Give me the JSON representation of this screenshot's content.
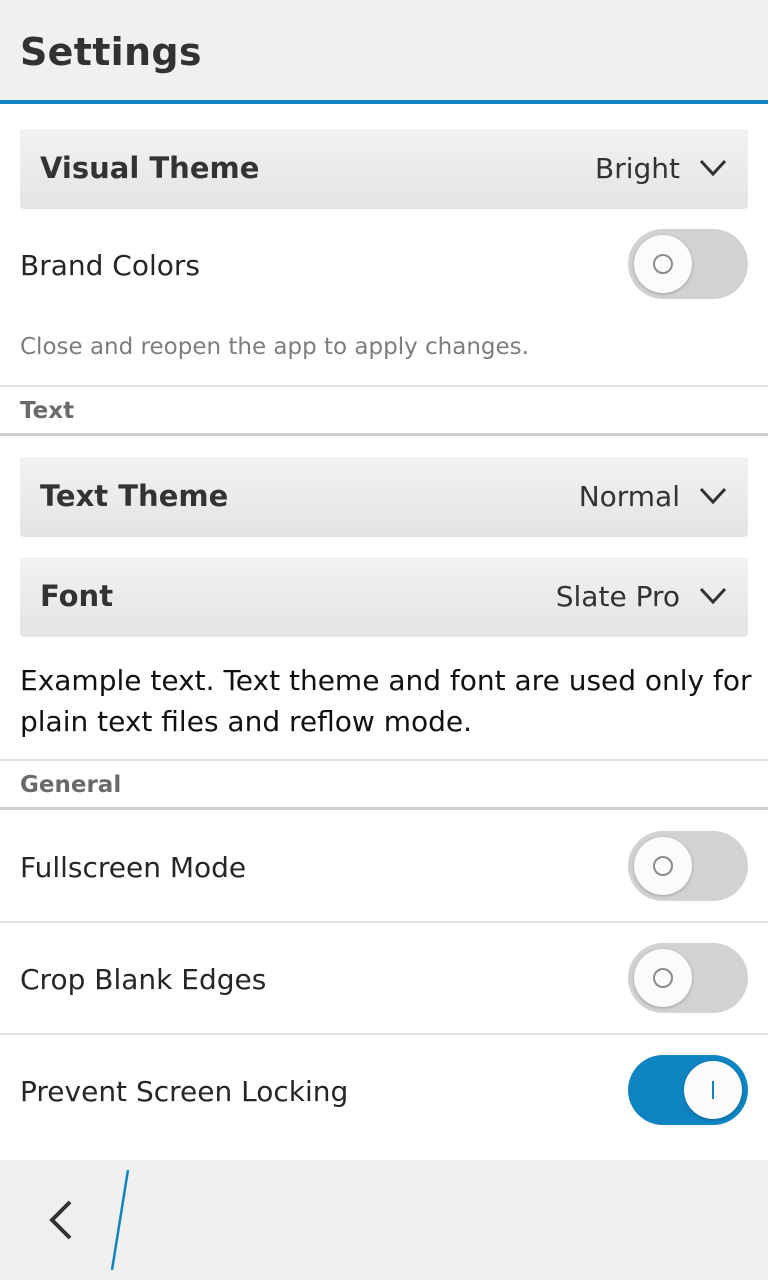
{
  "header": {
    "title": "Settings"
  },
  "appearance": {
    "visual_theme": {
      "label": "Visual Theme",
      "value": "Bright"
    },
    "brand_colors": {
      "label": "Brand Colors",
      "enabled": false
    },
    "hint": "Close and reopen the app to apply changes."
  },
  "text_section": {
    "header": "Text",
    "text_theme": {
      "label": "Text Theme",
      "value": "Normal"
    },
    "font": {
      "label": "Font",
      "value": "Slate Pro"
    },
    "example": "Example text. Text theme and font are used only for plain text files and reflow mode."
  },
  "general_section": {
    "header": "General",
    "fullscreen": {
      "label": "Fullscreen Mode",
      "enabled": false
    },
    "crop_edges": {
      "label": "Crop Blank Edges",
      "enabled": false
    },
    "prevent_lock": {
      "label": "Prevent Screen Locking",
      "enabled": true
    }
  },
  "colors": {
    "accent": "#0e84c0",
    "toggle_off": "#d2d2d2",
    "toggle_on": "#0f84c2"
  },
  "icons": {
    "back": "chevron-left-icon",
    "dropdown": "chevron-down-icon"
  }
}
